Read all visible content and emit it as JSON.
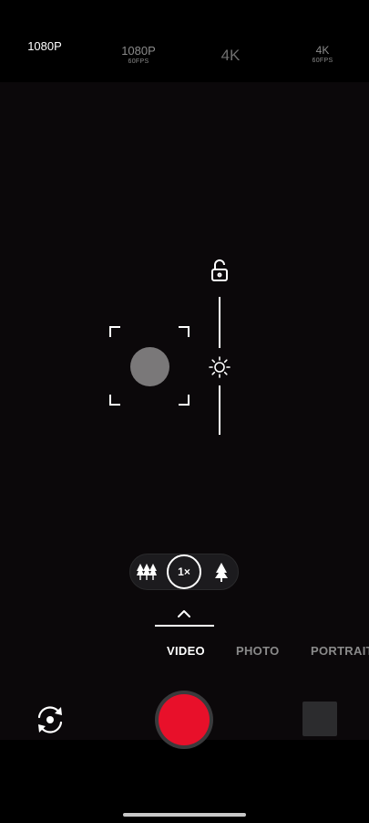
{
  "resolutions": [
    {
      "label": "1080P",
      "sub": "",
      "state": "selected"
    },
    {
      "label": "1080P",
      "sub": "60FPS",
      "state": "dim"
    },
    {
      "label": "4K",
      "sub": "",
      "state": "dim"
    },
    {
      "label": "4K",
      "sub": "60FPS",
      "state": "dim"
    }
  ],
  "zoom": {
    "current": "1×"
  },
  "modes": {
    "video": "VIDEO",
    "photo": "PHOTO",
    "portrait": "PORTRAIT"
  },
  "colors": {
    "shutter": "#e8102a",
    "background": "#000000",
    "viewfinder": "#0b080a"
  },
  "icons": {
    "exposure_lock": "unlock-icon",
    "exposure": "sun-icon",
    "zoom_wide": "trees-icon",
    "zoom_tele": "tree-icon",
    "switch_camera": "rotate-camera-icon",
    "mode_expand": "chevron-up-icon"
  }
}
